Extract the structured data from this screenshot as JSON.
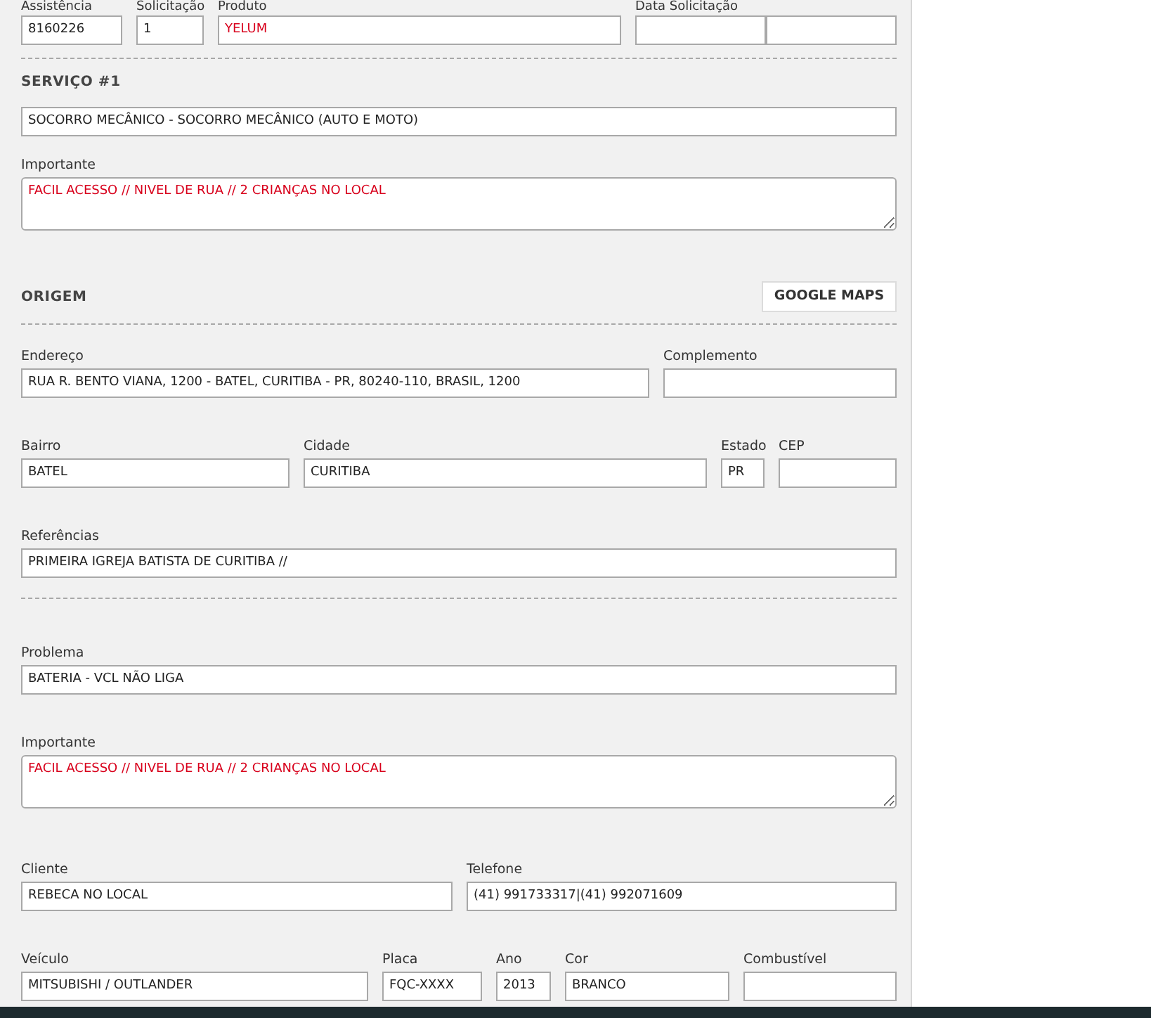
{
  "blocks": [
    {
      "kind": "row",
      "fields": [
        {
          "label": "Assistência",
          "kind": "input",
          "inputs": [
            {
              "value": "8160226",
              "highlight": false
            }
          ]
        },
        {
          "label": "Solicitação",
          "kind": "input",
          "inputs": [
            {
              "value": "1",
              "highlight": false
            }
          ]
        },
        {
          "label": "Produto",
          "kind": "input",
          "inputs": [
            {
              "value": "YELUM",
              "highlight": true
            }
          ]
        },
        {
          "label": "Data Solicitação",
          "kind": "double_input"
        }
      ]
    },
    {
      "kind": "divider"
    },
    {
      "kind": "heading",
      "title": "SERVIÇO #1"
    },
    {
      "kind": "row",
      "fields": [
        {
          "kind": "input",
          "inputs": [
            {
              "value": "SOCORRO MECÂNICO - SOCORRO MECÂNICO (AUTO E MOTO)",
              "highlight": false
            }
          ]
        }
      ]
    },
    {
      "kind": "row",
      "fields": [
        {
          "label": "Importante",
          "kind": "textarea",
          "inputs": [
            {
              "value": "FACIL ACESSO // NIVEL DE RUA // 2 CRIANÇAS NO LOCAL",
              "highlight": true
            }
          ]
        }
      ]
    },
    {
      "kind": "heading",
      "title": "ORIGEM",
      "button": "GOOGLE MAPS"
    },
    {
      "kind": "divider"
    },
    {
      "kind": "row",
      "fields": [
        {
          "label": "Endereço",
          "kind": "input",
          "inputs": [
            {
              "value": "RUA R. BENTO VIANA, 1200 - BATEL, CURITIBA - PR, 80240-110, BRASIL, 1200",
              "highlight": false
            }
          ]
        },
        {
          "label": "Complemento",
          "kind": "input"
        }
      ]
    },
    {
      "kind": "row",
      "fields": [
        {
          "label": "Bairro",
          "kind": "input",
          "inputs": [
            {
              "value": "BATEL",
              "highlight": false
            }
          ]
        },
        {
          "label": "Cidade",
          "kind": "input",
          "inputs": [
            {
              "value": "CURITIBA",
              "highlight": false
            }
          ]
        },
        {
          "label": "Estado",
          "kind": "input",
          "inputs": [
            {
              "value": "PR",
              "highlight": false
            }
          ]
        },
        {
          "label": "CEP",
          "kind": "input"
        }
      ]
    },
    {
      "kind": "row",
      "fields": [
        {
          "label": "Referências",
          "kind": "input",
          "inputs": [
            {
              "value": "PRIMEIRA IGREJA BATISTA DE CURITIBA //",
              "highlight": false
            }
          ]
        }
      ]
    },
    {
      "kind": "divider"
    },
    {
      "kind": "row",
      "fields": [
        {
          "label": "Problema",
          "kind": "input",
          "inputs": [
            {
              "value": "BATERIA - VCL NÃO LIGA",
              "highlight": false
            }
          ]
        }
      ]
    },
    {
      "kind": "row",
      "fields": [
        {
          "label": "Importante",
          "kind": "textarea",
          "inputs": [
            {
              "value": "FACIL ACESSO // NIVEL DE RUA // 2 CRIANÇAS NO LOCAL",
              "highlight": true
            }
          ]
        }
      ]
    },
    {
      "kind": "row",
      "fields": [
        {
          "label": "Cliente",
          "kind": "input",
          "inputs": [
            {
              "value": "REBECA NO LOCAL",
              "highlight": false
            }
          ]
        },
        {
          "label": "Telefone",
          "kind": "input",
          "inputs": [
            {
              "value": "(41) 991733317|(41) 992071609",
              "highlight": false
            }
          ]
        }
      ]
    },
    {
      "kind": "row",
      "fields": [
        {
          "label": "Veículo",
          "kind": "input",
          "inputs": [
            {
              "value": "MITSUBISHI / OUTLANDER",
              "highlight": false
            }
          ]
        },
        {
          "label": "Placa",
          "kind": "input",
          "inputs": [
            {
              "value": "FQC-XXXX",
              "highlight": false
            }
          ]
        },
        {
          "label": "Ano",
          "kind": "input",
          "inputs": [
            {
              "value": "2013",
              "highlight": false
            }
          ]
        },
        {
          "label": "Cor",
          "kind": "input",
          "inputs": [
            {
              "value": "BRANCO",
              "highlight": false
            }
          ]
        },
        {
          "label": "Combustível",
          "kind": "input"
        }
      ]
    }
  ]
}
